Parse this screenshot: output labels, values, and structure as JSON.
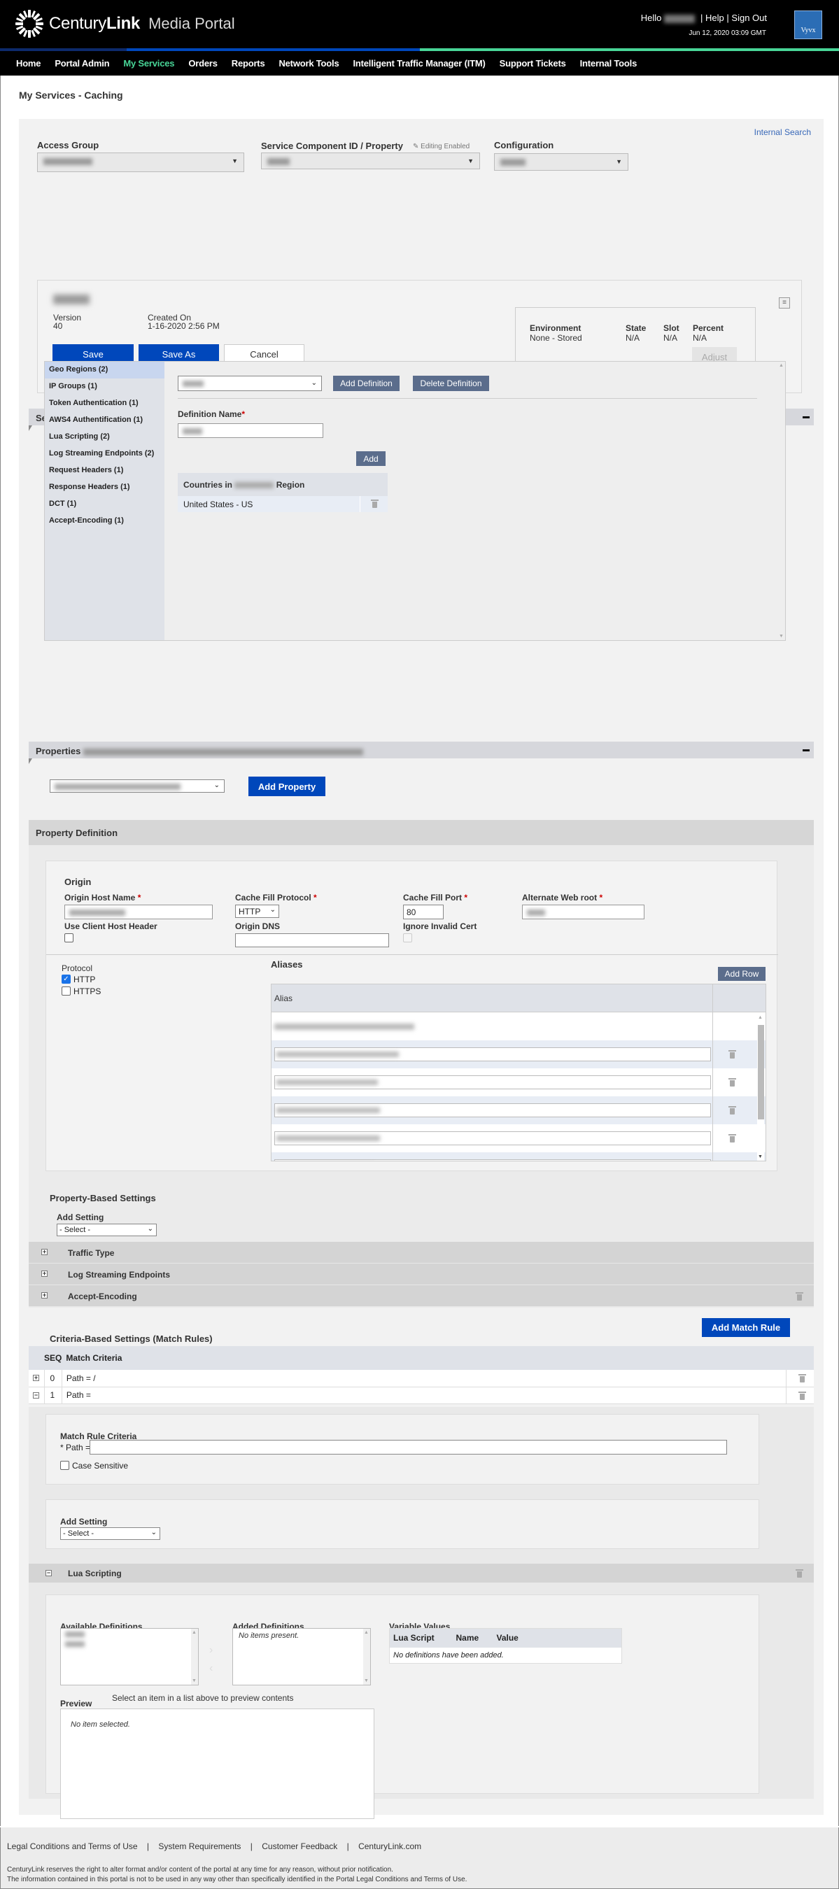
{
  "header": {
    "brand_light": "Century",
    "brand_bold": "Link",
    "portal_name": "Media Portal",
    "hello_label": "Hello",
    "help_label": "Help",
    "signout_label": "Sign Out",
    "separator": "|",
    "datetime": "Jun 12, 2020 03:09 GMT",
    "partner_logo_text": "Vyvx"
  },
  "nav": {
    "items": [
      {
        "label": "Home"
      },
      {
        "label": "Portal Admin"
      },
      {
        "label": "My Services",
        "active": true
      },
      {
        "label": "Orders"
      },
      {
        "label": "Reports"
      },
      {
        "label": "Network Tools"
      },
      {
        "label": "Intelligent Traffic Manager (ITM)"
      },
      {
        "label": "Support Tickets"
      },
      {
        "label": "Internal Tools"
      }
    ]
  },
  "page": {
    "title": "My Services - Caching",
    "internal_search": "Internal Search"
  },
  "selectors": {
    "access_group_label": "Access Group",
    "service_component_label": "Service Component ID / Property",
    "editing_enabled": "Editing Enabled",
    "configuration_label": "Configuration"
  },
  "config_card": {
    "version_label": "Version",
    "version_value": "40",
    "created_label": "Created On",
    "created_value": "1-16-2020 2:56 PM",
    "save": "Save",
    "save_as": "Save As",
    "cancel": "Cancel",
    "env_headers": [
      "Environment",
      "State",
      "Slot",
      "Percent"
    ],
    "env_values": [
      "None - Stored",
      "N/A",
      "N/A",
      "N/A"
    ],
    "adjust": "Adjust"
  },
  "service_wide": {
    "title": "Service-Wide Definition",
    "nav_items": [
      {
        "label": "Geo Regions (2)",
        "active": true
      },
      {
        "label": "IP Groups (1)"
      },
      {
        "label": "Token Authentication (1)"
      },
      {
        "label": "AWS4 Authentification (1)"
      },
      {
        "label": "Lua Scripting (2)"
      },
      {
        "label": "Log Streaming Endpoints (2)"
      },
      {
        "label": "Request Headers (1)"
      },
      {
        "label": "Response Headers (1)"
      },
      {
        "label": "DCT (1)"
      },
      {
        "label": "Accept-Encoding (1)"
      }
    ],
    "add_definition": "Add Definition",
    "delete_definition": "Delete Definition",
    "definition_name_label": "Definition Name",
    "add": "Add",
    "countries_prefix": "Countries in",
    "countries_suffix": "Region",
    "countries": [
      "United States - US"
    ]
  },
  "properties": {
    "title": "Properties",
    "add_property": "Add Property",
    "definition_title": "Property Definition"
  },
  "origin": {
    "title": "Origin",
    "host_label": "Origin Host Name",
    "protocol_label": "Cache Fill Protocol",
    "protocol_value": "HTTP",
    "port_label": "Cache Fill Port",
    "port_value": "80",
    "webroot_label": "Alternate Web root",
    "client_host_label": "Use Client Host Header",
    "dns_label": "Origin DNS",
    "dns_value": "",
    "ignore_cert_label": "Ignore Invalid Cert",
    "required_mark": "*",
    "protocol_section": "Protocol",
    "protocols": [
      {
        "label": "HTTP",
        "checked": true
      },
      {
        "label": "HTTPS",
        "checked": false
      }
    ],
    "aliases_title": "Aliases",
    "add_row": "Add Row",
    "alias_header": "Alias"
  },
  "property_settings": {
    "title": "Property-Based Settings",
    "add_setting_label": "Add Setting",
    "select_value": "- Select -",
    "rows": [
      "Traffic Type",
      "Log Streaming Endpoints",
      "Accept-Encoding"
    ]
  },
  "match_rules": {
    "title": "Criteria-Based Settings (Match Rules)",
    "add_button": "Add Match Rule",
    "headers": [
      "SEQ",
      "Match Criteria"
    ],
    "rows": [
      {
        "seq": "0",
        "criteria": "Path = /",
        "expanded": false
      },
      {
        "seq": "1",
        "criteria": "Path =",
        "expanded": true
      }
    ],
    "criteria_title": "Match Rule Criteria",
    "path_label": "* Path =",
    "path_value": "",
    "case_sensitive": "Case Sensitive",
    "add_setting_label": "Add Setting",
    "select_value": "- Select -"
  },
  "lua": {
    "title": "Lua Scripting",
    "available_label": "Available Definitions",
    "added_label": "Added Definitions",
    "added_empty": "No items present.",
    "variable_label": "Variable Values",
    "var_headers": [
      "Lua Script",
      "Name",
      "Value"
    ],
    "var_empty": "No definitions have been added.",
    "preview_label": "Preview",
    "preview_hint": "Select an item in a list above to preview contents",
    "preview_empty": "No item selected."
  },
  "footer": {
    "links": [
      "Legal Conditions and Terms of Use",
      "System Requirements",
      "Customer Feedback",
      "CenturyLink.com"
    ],
    "separator": "|",
    "notice1": "CenturyLink reserves the right to alter format and/or content of the portal at any time for any reason, without prior notification.",
    "notice2": "The information contained in this portal is not to be used in any way other than specifically identified in the Portal Legal Conditions and Terms of Use."
  }
}
